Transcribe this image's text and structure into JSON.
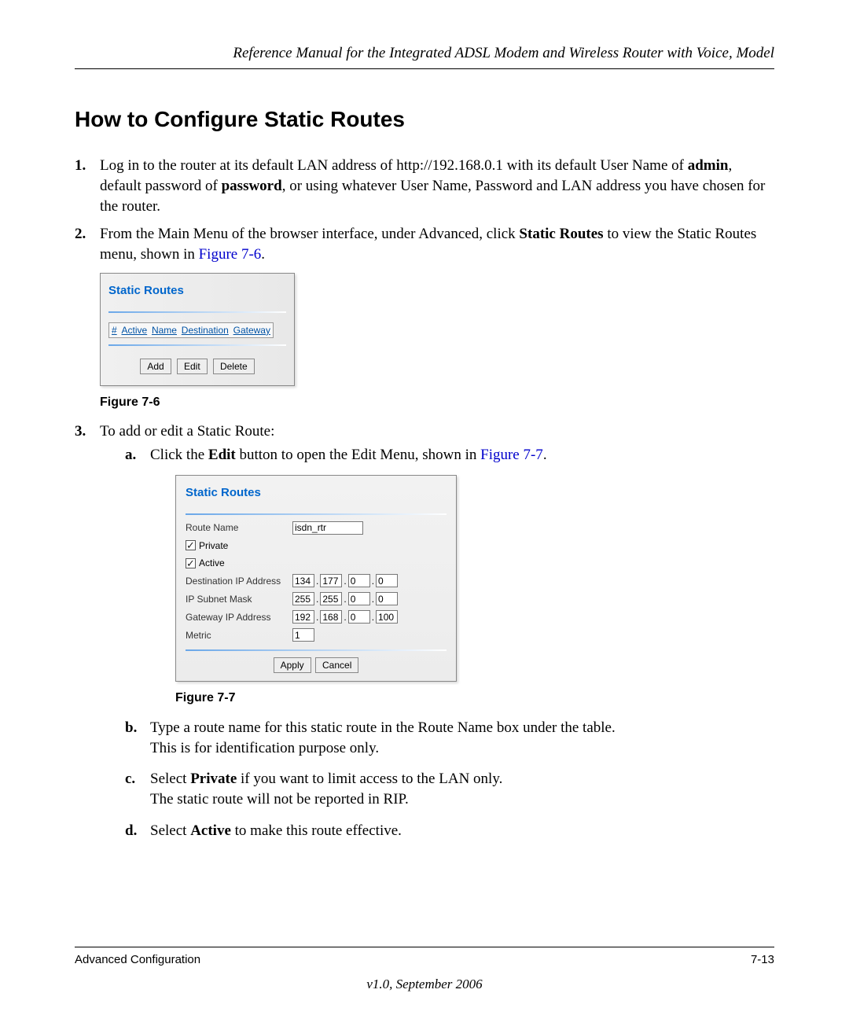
{
  "header": {
    "title": "Reference Manual for the Integrated ADSL Modem and Wireless Router with Voice, Model"
  },
  "section_title": "How to Configure Static Routes",
  "steps": {
    "s1_num": "1.",
    "s1_pre": "Log in to the router at its default LAN address of http://192.168.0.1 with its default User Name of ",
    "s1_admin": "admin",
    "s1_mid": ", default password of ",
    "s1_password": "password",
    "s1_post": ", or using whatever User Name, Password and LAN address you have chosen for the router.",
    "s2_num": "2.",
    "s2_pre": "From the Main Menu of the browser interface, under Advanced, click ",
    "s2_bold": "Static Routes",
    "s2_mid": " to view the Static Routes menu, shown in ",
    "s2_figref": "Figure 7-6",
    "s2_post": ".",
    "fig6_caption": "Figure 7-6",
    "s3_num": "3.",
    "s3_text": "To add or edit a Static Route:",
    "a_letter": "a.",
    "a_pre": "Click the ",
    "a_bold": "Edit",
    "a_mid": " button to open the Edit Menu, shown in ",
    "a_figref": "Figure 7-7",
    "a_post": ".",
    "fig7_caption": "Figure 7-7",
    "b_letter": "b.",
    "b_line1": "Type a route name for this static route in the Route Name box under the table.",
    "b_line2": "This is for identification purpose only.",
    "c_letter": "c.",
    "c_pre": "Select ",
    "c_bold": "Private",
    "c_line1_post": " if you want to limit access to the LAN only.",
    "c_line2": "The static route will not be reported in RIP.",
    "d_letter": "d.",
    "d_pre": "Select ",
    "d_bold": "Active",
    "d_post": " to make this route effective."
  },
  "shot1": {
    "title": "Static Routes",
    "cols": {
      "c0": "#",
      "c1": "Active",
      "c2": "Name",
      "c3": "Destination",
      "c4": "Gateway"
    },
    "btn_add": "Add",
    "btn_edit": "Edit",
    "btn_delete": "Delete"
  },
  "shot2": {
    "title": "Static Routes",
    "route_name_label": "Route Name",
    "route_name_value": "isdn_rtr",
    "private_label": "Private",
    "active_label": "Active",
    "dest_label": "Destination IP Address",
    "dest": {
      "a": "134",
      "b": "177",
      "c": "0",
      "d": "0"
    },
    "mask_label": "IP Subnet Mask",
    "mask": {
      "a": "255",
      "b": "255",
      "c": "0",
      "d": "0"
    },
    "gw_label": "Gateway IP Address",
    "gw": {
      "a": "192",
      "b": "168",
      "c": "0",
      "d": "100"
    },
    "metric_label": "Metric",
    "metric_value": "1",
    "btn_apply": "Apply",
    "btn_cancel": "Cancel"
  },
  "footer": {
    "left": "Advanced Configuration",
    "right": "7-13",
    "version": "v1.0, September 2006"
  }
}
